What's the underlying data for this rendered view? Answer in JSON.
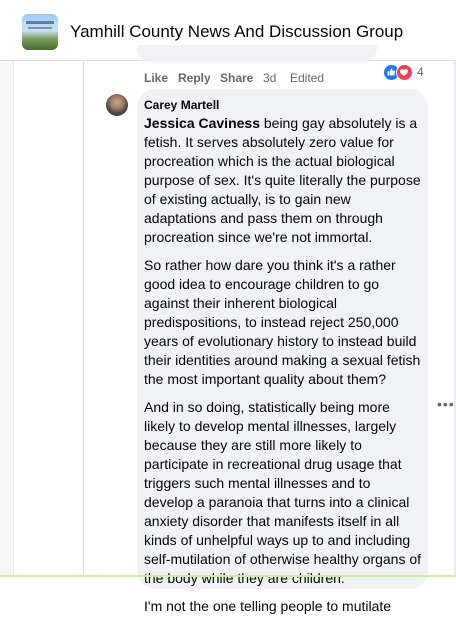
{
  "header": {
    "group_title": "Yamhill County News And Discussion Group",
    "avatar_icon": "group-cover-image"
  },
  "previous_comment": {
    "actions": {
      "like": "Like",
      "reply": "Reply",
      "share": "Share",
      "time": "3d",
      "edited": "Edited"
    },
    "reactions": {
      "types": [
        "like-icon",
        "love-icon"
      ],
      "count": "4"
    }
  },
  "comment": {
    "author": "Carey Martell",
    "mention": "Jessica Caviness",
    "paragraph1_rest": " being gay absolutely is a fetish. It serves absolutely zero value for procreation which is the actual biological purpose of sex. It's quite literally the purpose of existing actually, is to gain new adaptations and pass them on through procreation since we're not immortal.",
    "paragraph2": "So rather how dare you think it's a rather good idea to encourage children to go against their inherent biological predispositions, to instead reject 250,000 years of evolutionary history to instead build their identities around making a sexual fetish the most important quality about them?",
    "paragraph3": "And in so doing, statistically being more likely to develop mental illnesses, largely because they are still more likely to participate in recreational drug usage that triggers such mental illnesses and to develop a paranoia that turns into a clinical anxiety disorder that manifests itself in all kinds of unhelpful ways up to and including self-mutilation of otherwise healthy organs of the body while they are children.",
    "paragraph4": "I'm not the one telling people to mutilate"
  },
  "more_options_icon": "more-horizontal-icon",
  "colors": {
    "bubble": "#f0f2f5",
    "secondary_text": "#65676b",
    "like_blue": "#1877f2",
    "love_red": "#f33e58"
  }
}
